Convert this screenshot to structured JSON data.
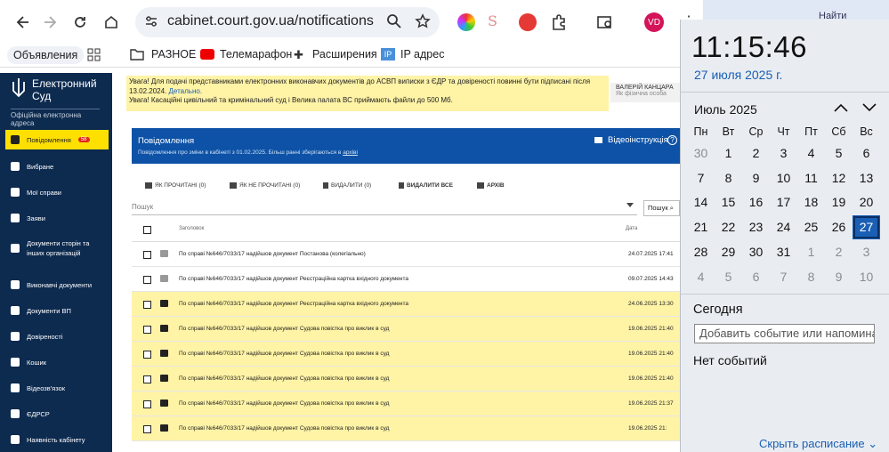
{
  "browser": {
    "url": "cabinet.court.gov.ua/notifications",
    "avatar": "VD"
  },
  "bookmarks": [
    {
      "label": "Объявления"
    },
    {
      "label": "РАЗНОЕ"
    },
    {
      "label": "Телемарафон"
    },
    {
      "label": "Расширения"
    },
    {
      "label": "IP адрес"
    }
  ],
  "bg_fragment": {
    "label": "Найти"
  },
  "sidebar": {
    "logo": "Електронний Суд",
    "subtitle": "Офіційна електронна адреса",
    "items": [
      {
        "label": "Повідомлення",
        "badge": "58",
        "icon": "chat-icon",
        "active": true
      },
      {
        "label": "Вибране",
        "icon": "star-icon"
      },
      {
        "label": "Мої справи",
        "icon": "folder-icon"
      },
      {
        "label": "Заяви",
        "icon": "list-icon"
      },
      {
        "label": "Документи сторін та інших організацій",
        "icon": "documents-icon"
      },
      {
        "label": "Виконавчі документи",
        "icon": "stack-icon"
      },
      {
        "label": "Документи ВП",
        "icon": "file-icon"
      },
      {
        "label": "Довіреності",
        "icon": "people-icon"
      },
      {
        "label": "Кошик",
        "icon": "trash-icon"
      },
      {
        "label": "Відеозв'язок",
        "icon": "video-icon"
      },
      {
        "label": "ЄДРСР",
        "icon": "gavel-icon"
      },
      {
        "label": "Наявність кабінету",
        "icon": "person-icon"
      }
    ]
  },
  "notice": {
    "line1": "Увага! Для подачі представниками електронних виконавчих документів до АСВП виписки з ЄДР та довіреності повинні бути підписані після",
    "line2a": "13.02.2024. ",
    "link": "Детально.",
    "line3": "Увага! Касаційні цивільний та кримінальний суд і Велика палата ВС приймають файли до 500 Мб."
  },
  "user": {
    "name": "ВАЛЕРІЙ КАНЦАРА",
    "role": "Як фізична особа"
  },
  "panel": {
    "title": "Повідомлення",
    "subtitle_a": "Повідомлення про зміни в кабінеті з 01.02.2025. Більш ранні зберігаються в ",
    "subtitle_link": "архіві",
    "video": "Відеоінструкція"
  },
  "toolbar": {
    "read": "ЯК ПРОЧИТАНІ (0)",
    "unread": "ЯК НЕ ПРОЧИТАНІ (0)",
    "delete": "ВИДАЛИТИ (0)",
    "delete_all": "ВИДАЛИТИ ВСЕ",
    "archive": "АРХІВ"
  },
  "search": {
    "placeholder": "Пошук",
    "button": "Пошук"
  },
  "table": {
    "headers": {
      "title": "Заголовок",
      "date": "Дата"
    },
    "rows": [
      {
        "title": "По справі №646/7033/17 надійшов документ Постанова (колегіально)",
        "date": "24.07.2025 17:41",
        "unread": false
      },
      {
        "title": "По справі №646/7033/17 надійшов документ Реєстраційна картка вхідного документа",
        "date": "09.07.2025 14:43",
        "unread": false
      },
      {
        "title": "По справі №646/7033/17 надійшов документ Реєстраційна картка вхідного документа",
        "date": "24.06.2025 13:30",
        "unread": true
      },
      {
        "title": "По справі №646/7033/17 надійшов документ Судова повістка про виклик в суд",
        "date": "19.06.2025 21:40",
        "unread": true
      },
      {
        "title": "По справі №646/7033/17 надійшов документ Судова повістка про виклик в суд",
        "date": "19.06.2025 21:40",
        "unread": true
      },
      {
        "title": "По справі №646/7033/17 надійшов документ Судова повістка про виклик в суд",
        "date": "19.06.2025 21:40",
        "unread": true
      },
      {
        "title": "По справі №646/7033/17 надійшов документ Судова повістка про виклик в суд",
        "date": "19.06.2025 21:37",
        "unread": true
      },
      {
        "title": "По справі №646/7033/17 надійшов документ Судова повістка про виклик в суд",
        "date": "19.06.2025 21:",
        "unread": true
      }
    ]
  },
  "flyout": {
    "time": "11:15:46",
    "date": "27 июля 2025 г.",
    "month": "Июль 2025",
    "weekdays": [
      "Пн",
      "Вт",
      "Ср",
      "Чт",
      "Пт",
      "Сб",
      "Вс"
    ],
    "weeks": [
      [
        "30",
        "1",
        "2",
        "3",
        "4",
        "5",
        "6"
      ],
      [
        "7",
        "8",
        "9",
        "10",
        "11",
        "12",
        "13"
      ],
      [
        "14",
        "15",
        "16",
        "17",
        "18",
        "19",
        "20"
      ],
      [
        "21",
        "22",
        "23",
        "24",
        "25",
        "26",
        "27"
      ],
      [
        "28",
        "29",
        "30",
        "31",
        "1",
        "2",
        "3"
      ],
      [
        "4",
        "5",
        "6",
        "7",
        "8",
        "9",
        "10"
      ]
    ],
    "today": "27",
    "today_label": "Сегодня",
    "event_placeholder": "Добавить событие или напоминан",
    "no_events": "Нет событий",
    "hide": "Скрыть расписание"
  }
}
